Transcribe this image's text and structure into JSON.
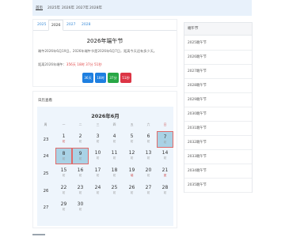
{
  "topnav": {
    "items": [
      "首页",
      "2025年",
      "2026年",
      "2027年",
      "2028年"
    ],
    "active_index": 0
  },
  "tabs": {
    "items": [
      "2025",
      "2026",
      "2027",
      "2028"
    ],
    "active_index": 1
  },
  "info": {
    "title": "2026年端午节",
    "line1": "端午2026年6月19日，2026年端午节是2026年6月7日，距离今天还有多少天。",
    "line2_prefix": "距离2026年端午：",
    "countdown": "356天 18时 37分 51秒",
    "buttons": [
      "36天",
      "18时",
      "37分",
      "51秒"
    ]
  },
  "calendar": {
    "header": "日历查看",
    "month_title": "2026年6月",
    "weekdays": [
      "周",
      "一",
      "二",
      "三",
      "四",
      "五",
      "六",
      "日"
    ],
    "weeks": [
      "23",
      "24",
      "25",
      "26",
      "27"
    ],
    "days": [
      [
        {
          "d": "1",
          "s": "初",
          "r": true
        },
        {
          "d": "2",
          "s": "初"
        },
        {
          "d": "3",
          "s": "初"
        },
        {
          "d": "4",
          "s": "初"
        },
        {
          "d": "5",
          "s": "初"
        },
        {
          "d": "6",
          "s": "初"
        },
        {
          "d": "7",
          "s": "初",
          "hl": true
        }
      ],
      [
        {
          "d": "8",
          "s": "初",
          "hl": true
        },
        {
          "d": "9",
          "s": "初",
          "hl": true
        },
        {
          "d": "10",
          "s": "初"
        },
        {
          "d": "11",
          "s": "初"
        },
        {
          "d": "12",
          "s": "初"
        },
        {
          "d": "13",
          "s": "初"
        },
        {
          "d": "14",
          "s": "初"
        }
      ],
      [
        {
          "d": "15",
          "s": "初"
        },
        {
          "d": "16",
          "s": "初"
        },
        {
          "d": "17",
          "s": "初"
        },
        {
          "d": "18",
          "s": "初"
        },
        {
          "d": "19",
          "s": "端",
          "r": true
        },
        {
          "d": "20",
          "s": "初"
        },
        {
          "d": "21",
          "s": "夏",
          "r": true
        }
      ],
      [
        {
          "d": "22",
          "s": "初"
        },
        {
          "d": "23",
          "s": "初"
        },
        {
          "d": "24",
          "s": "初"
        },
        {
          "d": "25",
          "s": "初"
        },
        {
          "d": "26",
          "s": "初"
        },
        {
          "d": "27",
          "s": "初"
        },
        {
          "d": "28",
          "s": "初"
        }
      ],
      [
        {
          "d": "29",
          "s": "初"
        },
        {
          "d": "30",
          "s": "初"
        }
      ]
    ]
  },
  "sidebar": {
    "title": "端午节",
    "items": [
      "2025端午节",
      "2026端午节",
      "2027端午节",
      "2028端午节",
      "2029端午节",
      "2030端午节",
      "2031端午节",
      "2032端午节",
      "2033端午节",
      "2034端午节",
      "2035端午节"
    ]
  },
  "colors": {
    "accent_blue": "#1e7fe0",
    "green": "#28a745",
    "red": "#dc3545",
    "nav_bg": "#e8f1fb",
    "highlight": "#a9d2e5"
  }
}
